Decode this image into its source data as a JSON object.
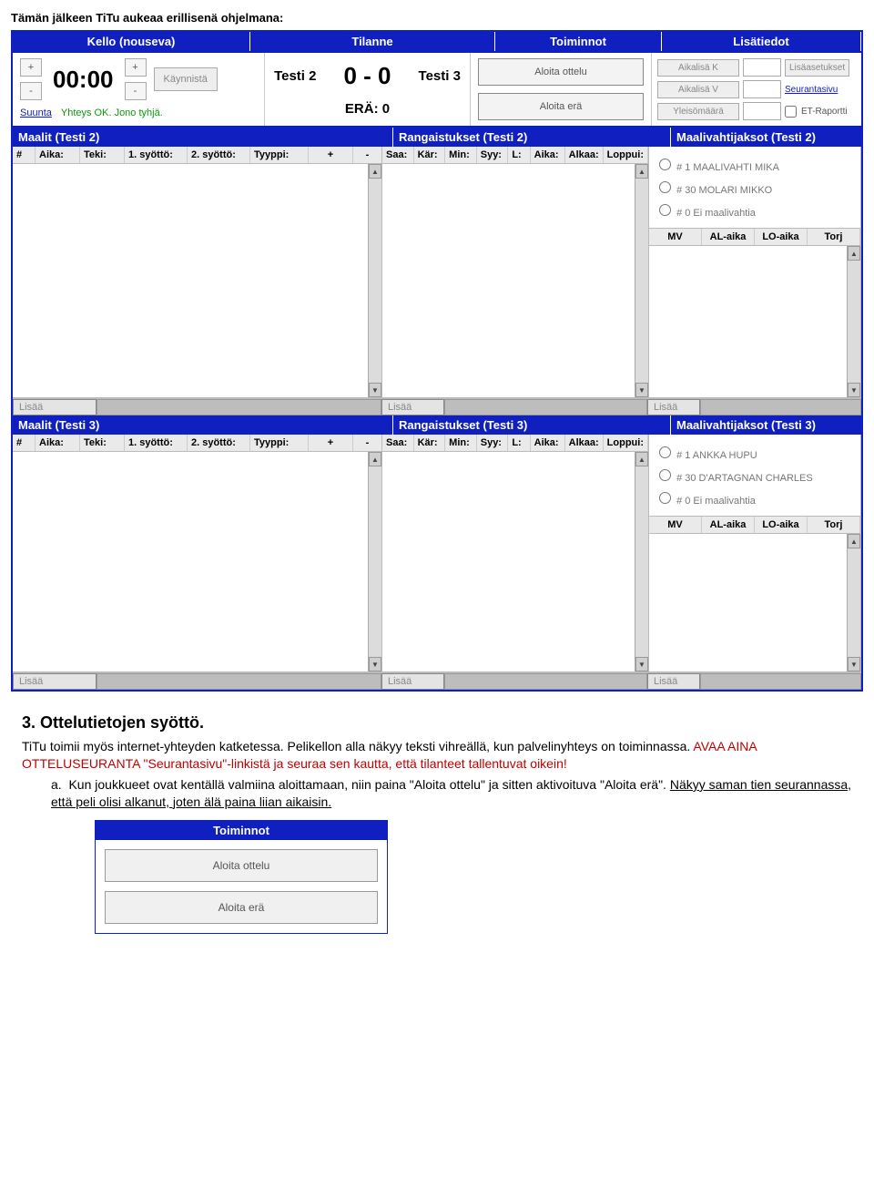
{
  "intro": "Tämän jälkeen TiTu aukeaa erillisenä ohjelmana:",
  "headers": {
    "clock": "Kello (nouseva)",
    "situation": "Tilanne",
    "actions": "Toiminnot",
    "info": "Lisätiedot"
  },
  "clock": {
    "time": "00:00",
    "start": "Käynnistä",
    "direction": "Suunta",
    "status": "Yhteys OK. Jono tyhjä."
  },
  "situation": {
    "home": "Testi 2",
    "score": "0 - 0",
    "away": "Testi 3",
    "period": "ERÄ: 0"
  },
  "actions": {
    "start_match": "Aloita ottelu",
    "start_period": "Aloita erä"
  },
  "info": {
    "timeout_home": "Aikalisä K",
    "timeout_away": "Aikalisä V",
    "attendance": "Yleisömäärä",
    "extra_settings": "Lisäasetukset",
    "tracking": "Seurantasivu",
    "et_report": "ET-Raportti"
  },
  "team2": {
    "goals_title": "Maalit (Testi 2)",
    "pen_title": "Rangaistukset (Testi 2)",
    "gk_title": "Maalivahtijaksot (Testi 2)",
    "gk_options": [
      "# 1 MAALIVAHTI MIKA",
      "# 30 MOLARI MIKKO",
      "# 0 Ei maalivahtia"
    ]
  },
  "team3": {
    "goals_title": "Maalit (Testi 3)",
    "pen_title": "Rangaistukset (Testi 3)",
    "gk_title": "Maalivahtijaksot (Testi 3)",
    "gk_options": [
      "# 1 ANKKA HUPU",
      "# 30 D'ARTAGNAN CHARLES",
      "# 0 Ei maalivahtia"
    ]
  },
  "cols": {
    "goals": [
      "#",
      "Aika:",
      "Teki:",
      "1. syöttö:",
      "2. syöttö:",
      "Tyyppi:",
      "+",
      "-"
    ],
    "pen": [
      "Saa:",
      "Kär:",
      "Min:",
      "Syy:",
      "L:",
      "Aika:",
      "Alkaa:",
      "Loppui:"
    ],
    "gk": [
      "MV",
      "AL-aika",
      "LO-aika",
      "Torj"
    ]
  },
  "add_label": "Lisää",
  "section3": {
    "title": "3. Ottelutietojen syöttö.",
    "p1a": "TiTu toimii myös internet-yhteyden katketessa. Pelikellon alla näkyy teksti vihreällä, kun palvelinyhteys on toiminnassa. ",
    "p1b": "AVAA AINA OTTELUSEURANTA \"Seurantasivu\"-linkistä ja seuraa sen kautta, että tilanteet tallentuvat oikein!",
    "a_label": "a.",
    "a_text1": "Kun joukkueet ovat kentällä valmiina aloittamaan, niin paina \"Aloita ottelu\" ja sitten aktivoituva \"Aloita erä\". ",
    "a_text2": "Näkyy saman tien seurannassa, että peli olisi alkanut, joten älä paina liian aikaisin."
  },
  "mini": {
    "header": "Toiminnot",
    "b1": "Aloita ottelu",
    "b2": "Aloita erä"
  }
}
